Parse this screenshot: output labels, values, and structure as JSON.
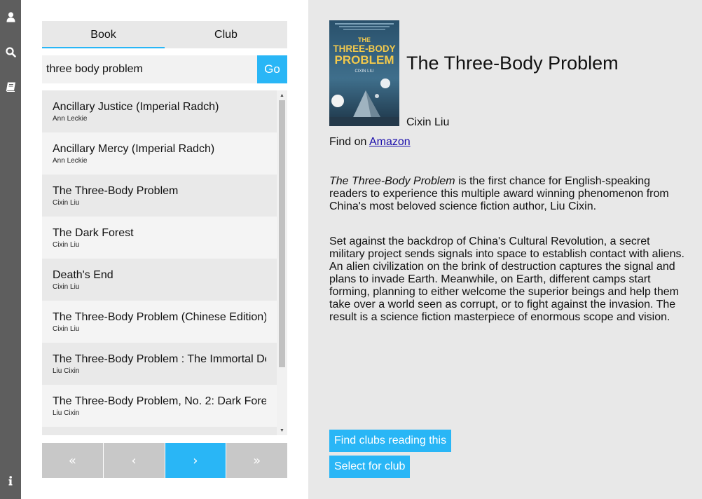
{
  "rail": {
    "icons": [
      "user-icon",
      "search-icon",
      "book-icon",
      "info-icon"
    ]
  },
  "tabs": [
    {
      "label": "Book",
      "active": true
    },
    {
      "label": "Club",
      "active": false
    }
  ],
  "search": {
    "value": "three body problem",
    "go_label": "Go"
  },
  "results": [
    {
      "title": "Ancillary Justice (Imperial Radch)",
      "author": "Ann Leckie"
    },
    {
      "title": "Ancillary Mercy (Imperial Radch)",
      "author": "Ann Leckie"
    },
    {
      "title": "The Three-Body Problem",
      "author": "Cixin Liu"
    },
    {
      "title": "The Dark Forest",
      "author": "Cixin Liu"
    },
    {
      "title": "Death's End",
      "author": "Cixin Liu"
    },
    {
      "title": "The Three-Body Problem (Chinese Edition)",
      "author": "Cixin Liu"
    },
    {
      "title": "The Three-Body Problem : The Immortal De",
      "author": "Liu Cixin"
    },
    {
      "title": "The Three-Body Problem, No. 2: Dark Fore",
      "author": "Liu Cixin"
    },
    {
      "title": "",
      "author": ""
    }
  ],
  "pager": {
    "first": "«",
    "prev": "‹",
    "next": "›",
    "last": "»"
  },
  "detail": {
    "title": "The Three-Body Problem",
    "author": "Cixin Liu",
    "find_on_prefix": "Find on",
    "find_on_link": "Amazon",
    "cover": {
      "title_line1": "THE",
      "title_line2": "THREE-BODY",
      "title_line3": "PROBLEM",
      "author": "CIXIN LIU",
      "colors": {
        "bg": "#3a5b74",
        "title": "#f2c94c"
      }
    },
    "description": {
      "p1_em": "The Three-Body Problem",
      "p1_rest": " is the first chance for English-speaking readers to experience this multiple award winning phenomenon from China's most beloved science fiction author, Liu Cixin.",
      "p2": "Set against the backdrop of China's Cultural Revolution, a secret military project sends signals into space to establish contact with aliens. An alien civilization on the brink of destruction captures the signal and plans to invade Earth. Meanwhile, on Earth, different camps start forming, planning to either welcome the superior beings and help them take over a world seen as corrupt, or to fight against the invasion. The result is a science fiction masterpiece of enormous scope and vision."
    },
    "find_clubs_label": "Find clubs reading this",
    "select_club_label": "Select for club"
  },
  "colors": {
    "accent": "#29b6f6",
    "rail": "#5e5e5e",
    "detail_bg": "#e8e8e8"
  }
}
